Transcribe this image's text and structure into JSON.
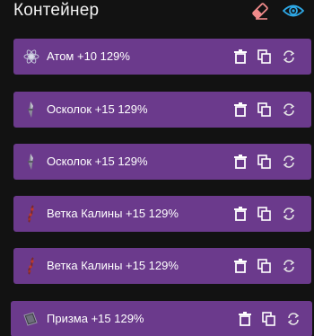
{
  "header": {
    "title": "Контейнер",
    "eraser_icon": "eraser-icon",
    "eye_icon": "eye-icon",
    "eraser_color": "#f08a8a",
    "eye_color": "#2ea8e6"
  },
  "row_color": "#6b3a8c",
  "items": [
    {
      "label": "Атом +10 129%",
      "icon": "atom-icon"
    },
    {
      "label": "Осколок +15 129%",
      "icon": "shard-icon"
    },
    {
      "label": "Осколок +15 129%",
      "icon": "shard-icon"
    },
    {
      "label": "Ветка Калины +15 129%",
      "icon": "viburnum-branch-icon"
    },
    {
      "label": "Ветка Калины +15 129%",
      "icon": "viburnum-branch-icon"
    },
    {
      "label": "Призма +15 129%",
      "icon": "prism-icon"
    }
  ],
  "actions": {
    "delete_icon": "trash-icon",
    "copy_icon": "copy-icon",
    "swap_icon": "swap-icon"
  }
}
